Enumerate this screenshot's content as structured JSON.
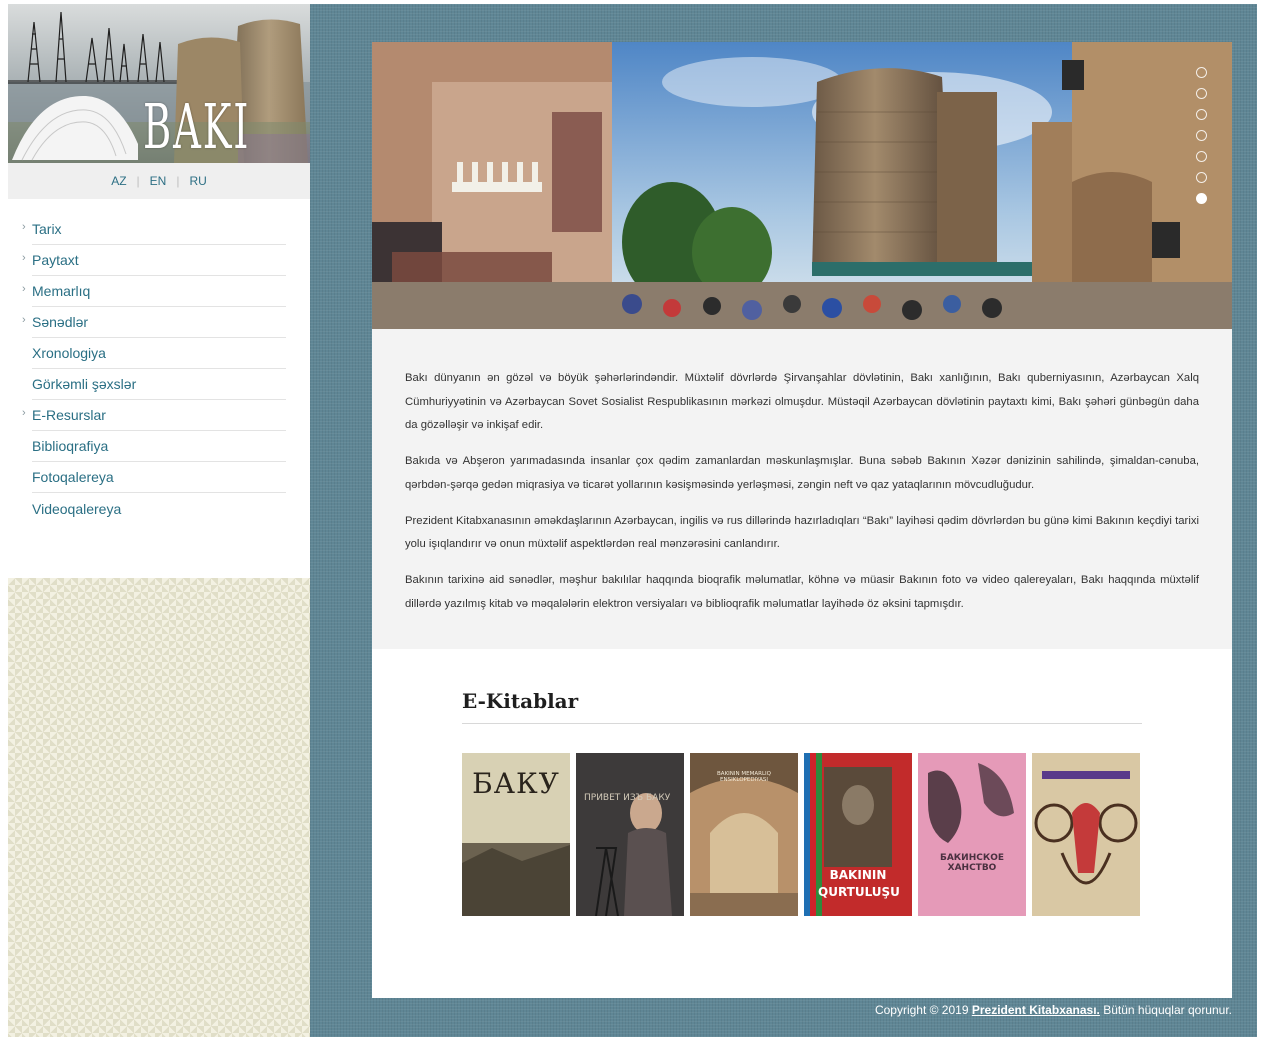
{
  "logo": {
    "text": "BAKI"
  },
  "languages": [
    "AZ",
    "EN",
    "RU"
  ],
  "nav": [
    {
      "label": "Tarix",
      "has_children": true
    },
    {
      "label": "Paytaxt",
      "has_children": true
    },
    {
      "label": "Memarlıq",
      "has_children": true
    },
    {
      "label": "Sənədlər",
      "has_children": true
    },
    {
      "label": "Xronologiya",
      "has_children": false
    },
    {
      "label": "Görkəmli şəxslər",
      "has_children": false
    },
    {
      "label": "E-Resurslar",
      "has_children": true
    },
    {
      "label": "Biblioqrafiya",
      "has_children": false
    },
    {
      "label": "Fotoqalereya",
      "has_children": false
    },
    {
      "label": "Videoqalereya",
      "has_children": false
    }
  ],
  "slider": {
    "slide_count": 7,
    "active_index": 6
  },
  "intro": {
    "paragraphs": [
      "Bakı dünyanın ən gözəl və böyük şəhərlərindəndir. Müxtəlif dövrlərdə Şirvanşahlar dövlətinin, Bakı xanlığının, Bakı quberniyasının, Azərbaycan Xalq Cümhuriyyətinin və Azərbaycan Sovet Sosialist Respublikasının mərkəzi olmuşdur. Müstəqil Azərbaycan dövlətinin paytaxtı kimi, Bakı şəhəri günbəgün daha da gözəlləşir və inkişaf edir.",
      "Bakıda və Abşeron yarımadasında insanlar çox qədim zamanlardan məskunlaşmışlar. Buna səbəb Bakının Xəzər dənizinin sahilində, şimaldan-cənuba, qərbdən-şərqə gedən miqrasiya və ticarət yollarının kəsişməsində yerləşməsi, zəngin neft və qaz yataqlarının mövcudluğudur.",
      "Prezident Kitabxanasının əməkdaşlarının Azərbaycan, ingilis və rus dillərində hazırladıqları “Bakı” layihəsi qədim dövrlərdən bu günə kimi Bakının keçdiyi tarixi yolu işıqlandırır və onun müxtəlif aspektlərdən real mənzərəsini canlandırır.",
      "Bakının tarixinə aid sənədlər, məşhur bakılılar haqqında bioqrafik məlumatlar, köhnə və müasir Bakının foto və video qalereyaları, Bakı haqqında müxtəlif dillərdə yazılmış kitab və məqalələrin elektron versiyaları və biblioqrafik məlumatlar layihədə öz əksini tapmışdır."
    ]
  },
  "ebooks": {
    "title": "E-Kitablar",
    "books": [
      {
        "cover_text": "БАКУ",
        "color": "#cfc7a6"
      },
      {
        "cover_text": "ПРИВЕТ ИЗЪ БАКУ",
        "color": "#3d3a3a"
      },
      {
        "cover_text": "BAKININ MEMARLIQ ENSIKLOPEDIYASI",
        "color": "#b58a62"
      },
      {
        "cover_text": "BAKININ QURTULUŞU",
        "color": "#c22b2b"
      },
      {
        "cover_text": "БАКИНСКОЕ ХАНСТВО",
        "color": "#e59ab8"
      },
      {
        "cover_text": "",
        "color": "#d9c8a4"
      }
    ]
  },
  "footer": {
    "prefix": "Copyright © 2019",
    "link": "Prezident Kitabxanası.",
    "suffix": "Bütün hüquqlar qorunur."
  },
  "colors": {
    "link": "#2a6f84",
    "main_bg": "#5f8695",
    "intro_bg": "#f3f3f3"
  }
}
